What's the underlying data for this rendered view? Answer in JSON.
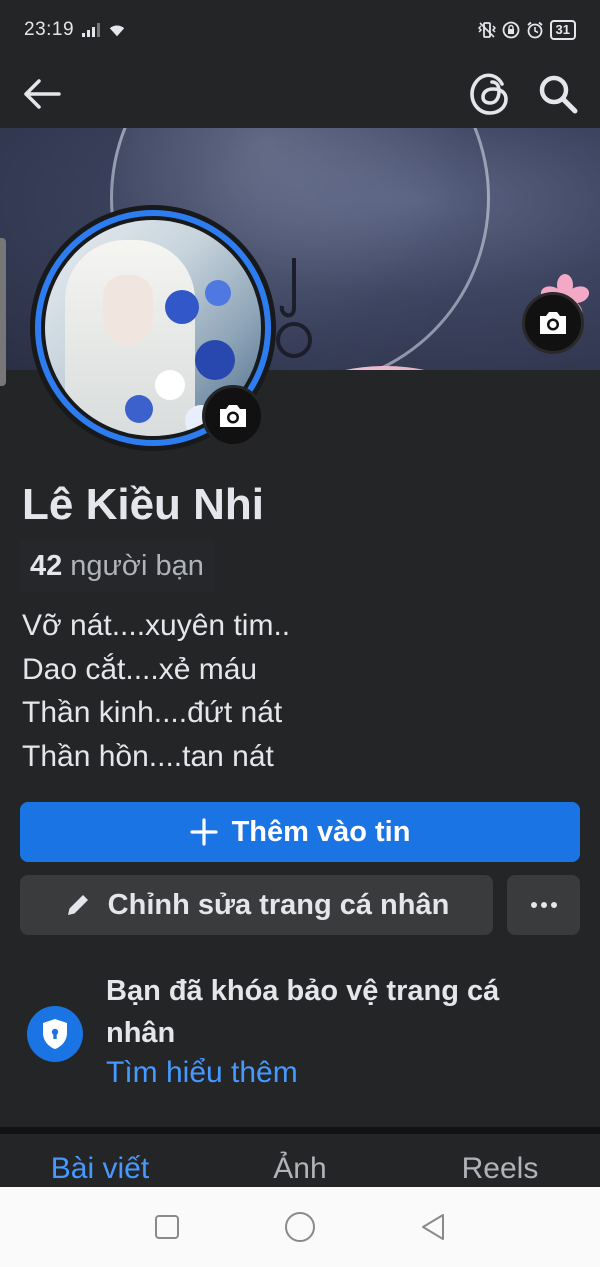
{
  "status_bar": {
    "time": "23:19",
    "battery": "31",
    "icons": [
      "signal-icon",
      "wifi-icon",
      "vibrate-icon",
      "lock-rotation-icon",
      "alarm-icon",
      "battery-icon"
    ]
  },
  "top_nav": {
    "icons": [
      "back-arrow-icon",
      "threads-icon",
      "search-icon"
    ]
  },
  "profile": {
    "name": "Lê Kiều Nhi",
    "friend_count": "42",
    "friend_label": "người bạn",
    "bio": [
      "Vỡ nát....xuyên tim..",
      "Dao cắt....xẻ máu",
      "Thần kinh....đứt nát",
      "Thần hồn....tan nát"
    ]
  },
  "actions": {
    "add_story": "Thêm vào tin",
    "edit_profile": "Chỉnh sửa trang cá nhân"
  },
  "lock_notice": {
    "title": "Bạn đã khóa bảo vệ trang cá nhân",
    "link": "Tìm hiểu thêm"
  },
  "tabs": [
    {
      "label": "Bài viết",
      "active": true
    },
    {
      "label": "Ảnh",
      "active": false
    },
    {
      "label": "Reels",
      "active": false
    }
  ],
  "colors": {
    "background": "#242526",
    "accent": "#1b74e4",
    "link": "#4599ff",
    "secondary_button": "#3a3b3c"
  }
}
